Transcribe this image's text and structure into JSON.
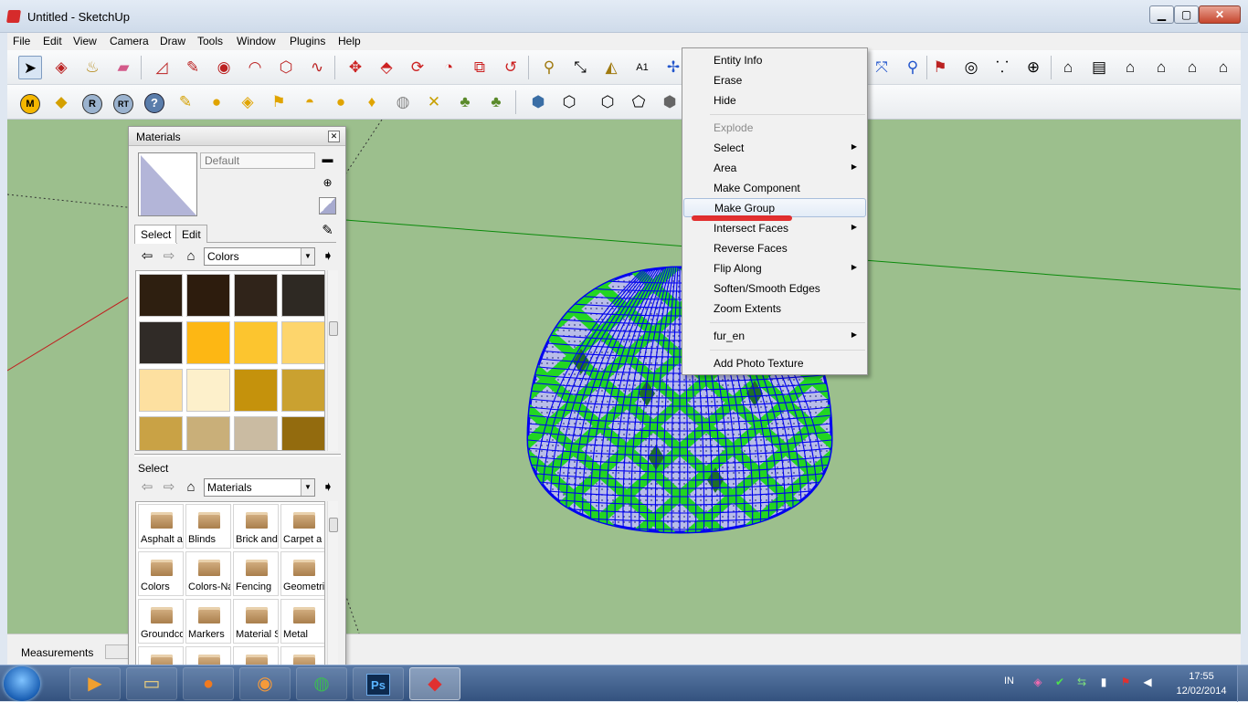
{
  "window": {
    "title": "Untitled - SketchUp",
    "minimize": "▁",
    "maximize": "▢",
    "close": "✕"
  },
  "menubar": [
    "File",
    "Edit",
    "View",
    "Camera",
    "Draw",
    "Tools",
    "Window",
    "Plugins",
    "Help"
  ],
  "toolbar1_icons": [
    "select-icon",
    "make-component-icon",
    "paint-bucket-icon",
    "eraser-icon",
    "rectangle-icon",
    "line-icon",
    "circle-icon",
    "arc-icon",
    "polygon-icon",
    "freehand-icon",
    "move-icon",
    "push-pull-icon",
    "rotate-icon",
    "follow-me-icon",
    "scale-icon",
    "offset-icon",
    "tape-measure-icon",
    "dimension-icon",
    "protractor-icon",
    "text-icon",
    "axes-icon",
    "zoom-extents-icon",
    "previous-view-icon",
    "position-camera-icon",
    "look-around-icon",
    "walk-icon",
    "section-plane-icon",
    "iso-view-icon",
    "top-view-icon",
    "front-view-icon",
    "right-view-icon",
    "back-view-icon",
    "left-view-icon"
  ],
  "toolbar2_icons": [
    "m-plugin-icon",
    "tag-plugin-icon",
    "r-plugin-icon",
    "rt-plugin-icon",
    "help-icon",
    "label-icon",
    "sphere-icon",
    "plane-icon",
    "flag-icon",
    "dome-icon",
    "half-sphere-icon",
    "lamp-icon",
    "globe-icon",
    "stairs-icon",
    "tree-icon",
    "tree-small-icon",
    "xray-icon",
    "wireframe-icon",
    "hidden-line-icon",
    "shaded-icon",
    "shaded-texture-icon"
  ],
  "materials": {
    "title": "Materials",
    "close": "✕",
    "name_placeholder": "Default",
    "tabs": {
      "select": "Select",
      "edit": "Edit"
    },
    "collection1": "Colors",
    "select_label": "Select",
    "collection2": "Materials",
    "swatches": [
      "#2e1f10",
      "#2d1c0d",
      "#30241a",
      "#2e2923",
      "#302b27",
      "#fdb714",
      "#fcc52f",
      "#fdd56c",
      "#fde0a0",
      "#fdf0cb",
      "#c5920c",
      "#caa130",
      "#c9a245",
      "#c9af79",
      "#cabba2",
      "#936b0e"
    ],
    "folders": [
      "Asphalt a",
      "Blinds",
      "Brick and",
      "Carpet a",
      "Colors",
      "Colors-Na",
      "Fencing",
      "Geometri",
      "Groundco",
      "Markers",
      "Material S",
      "Metal",
      "",
      "",
      "",
      ""
    ]
  },
  "context_menu": {
    "entity_info": "Entity Info",
    "erase": "Erase",
    "hide": "Hide",
    "explode": "Explode",
    "select": "Select",
    "area": "Area",
    "make_component": "Make Component",
    "make_group": "Make Group",
    "intersect_faces": "Intersect Faces",
    "reverse_faces": "Reverse Faces",
    "flip_along": "Flip Along",
    "soften_edges": "Soften/Smooth Edges",
    "zoom_extents": "Zoom Extents",
    "fur_en": "fur_en",
    "add_photo_texture": "Add Photo Texture"
  },
  "status": {
    "measurements": "Measurements"
  },
  "taskbar": {
    "apps": [
      "media-player-icon",
      "file-explorer-icon",
      "firefox-icon",
      "ubuntu-icon",
      "chrome-icon",
      "photoshop-icon",
      "sketchup-icon"
    ],
    "ps_label": "Ps",
    "language": "IN",
    "time": "17:55",
    "date": "12/02/2014"
  },
  "colors": {
    "viewport_bg": "#9cbf8d",
    "dome_edges": "#0000f0",
    "dome_face": "#b7bce6",
    "dome_stripe": "#22d622",
    "highlight_underline": "#e01b1b"
  }
}
